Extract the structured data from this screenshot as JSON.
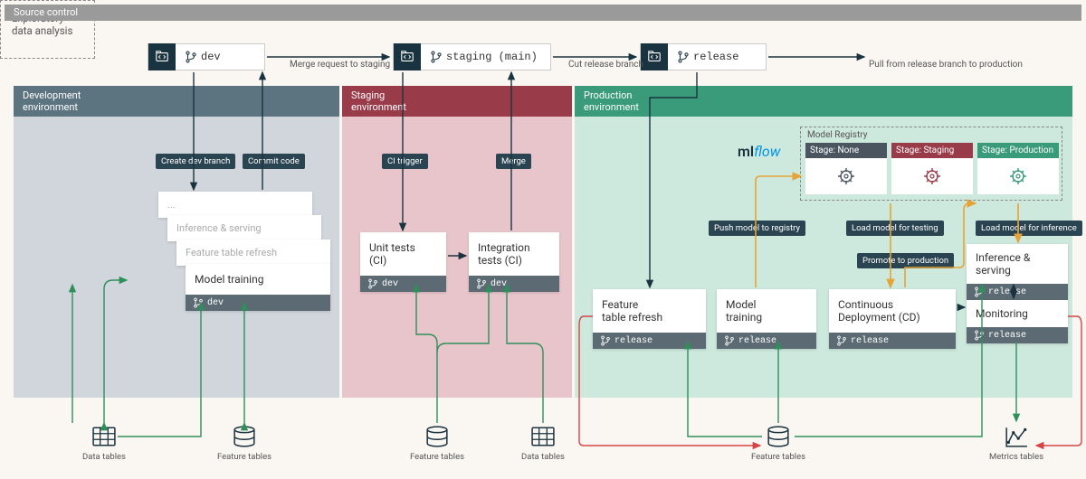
{
  "source_control_label": "Source control",
  "branches": {
    "dev": "dev",
    "staging": "staging (main)",
    "release": "release"
  },
  "branch_arrows": {
    "merge_to_staging": "Merge request to staging",
    "cut_release": "Cut release branch",
    "pull_to_prod": "Pull from release branch to production"
  },
  "environments": {
    "dev": {
      "title_l1": "Development",
      "title_l2": "environment"
    },
    "staging": {
      "title_l1": "Staging",
      "title_l2": "environment"
    },
    "prod": {
      "title_l1": "Production",
      "title_l2": "environment"
    }
  },
  "dev": {
    "create_branch": "Create dev branch",
    "commit_code": "Commit code",
    "eda": "Exploratory data analysis",
    "stack_dots": "...",
    "inference": "Inference & serving",
    "feature_refresh": "Feature table refresh",
    "model_training": "Model training",
    "footer": "dev"
  },
  "staging": {
    "ci_trigger": "CI trigger",
    "merge": "Merge",
    "unit_tests_l1": "Unit tests",
    "unit_tests_l2": "(CI)",
    "integ_tests_l1": "Integration",
    "integ_tests_l2": "tests (CI)",
    "footer": "dev"
  },
  "prod": {
    "mlflow_ml": "ml",
    "mlflow_flow": "flow",
    "registry_title": "Model Registry",
    "stage_none": "Stage: None",
    "stage_staging": "Stage: Staging",
    "stage_production": "Stage: Production",
    "push_model": "Push model to registry",
    "load_testing": "Load model for testing",
    "promote": "Promote to production",
    "load_inference": "Load model for inference",
    "feature_refresh_l1": "Feature",
    "feature_refresh_l2": "table refresh",
    "model_training_l1": "Model",
    "model_training_l2": "training",
    "cd_l1": "Continuous",
    "cd_l2": "Deployment (CD)",
    "inference_serving": "Inference & serving",
    "monitoring": "Monitoring",
    "footer": "release"
  },
  "datasources": {
    "data_tables": "Data tables",
    "feature_tables": "Feature tables",
    "metrics_tables": "Metrics tables"
  },
  "colors": {
    "dark": "#1a3340",
    "orange": "#e6a336",
    "green": "#2f8f5b",
    "red": "#d64545",
    "stage_none": "#4a5560",
    "stage_staging": "#9a3b4a",
    "stage_prod": "#3a9b7a"
  }
}
